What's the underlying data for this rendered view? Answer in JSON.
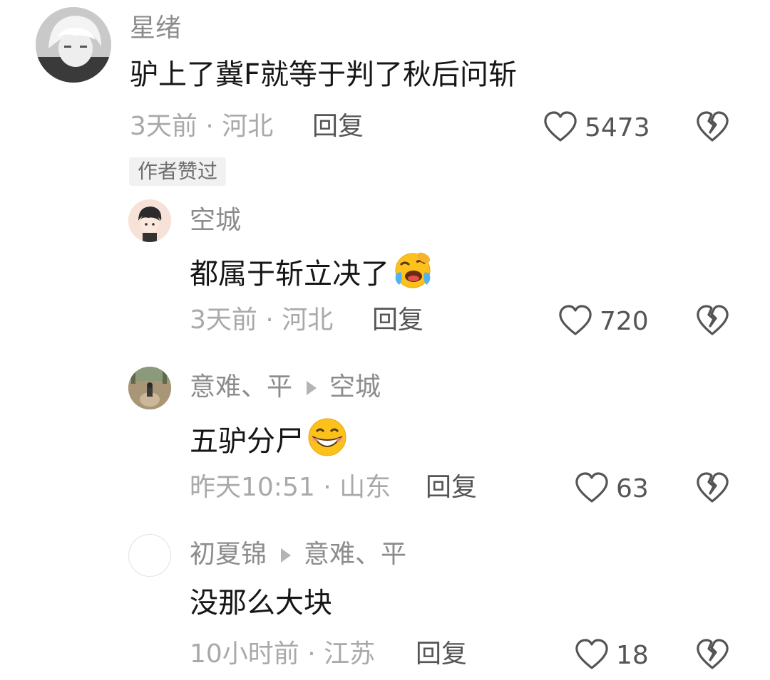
{
  "comments": [
    {
      "author": "星绪",
      "text": "驴上了冀F就等于判了秋后问斩",
      "time": "3天前 · 河北",
      "reply_label": "回复",
      "likes": "5473",
      "badge": "作者赞过"
    },
    {
      "author": "空城",
      "text": "都属于斩立决了",
      "emoji": "laughing-crying-emoji",
      "time": "3天前 · 河北",
      "reply_label": "回复",
      "likes": "720"
    },
    {
      "author": "意难、平",
      "reply_to": "空城",
      "text": "五驴分尸",
      "emoji": "grinning-emoji",
      "time": "昨天10:51 · 山东",
      "reply_label": "回复",
      "likes": "63"
    },
    {
      "author": "初夏锦",
      "reply_to": "意难、平",
      "text": "没那么大块",
      "time": "10小时前 · 江苏",
      "reply_label": "回复",
      "likes": "18"
    }
  ],
  "icons": {
    "like": "heart-outline-icon",
    "dislike": "broken-heart-icon",
    "reply_arrow": "triangle-right-icon"
  },
  "colors": {
    "name": "#8c8c8c",
    "content": "#161616",
    "meta": "#a9a9a9",
    "badge_bg": "#f1f1f1"
  }
}
